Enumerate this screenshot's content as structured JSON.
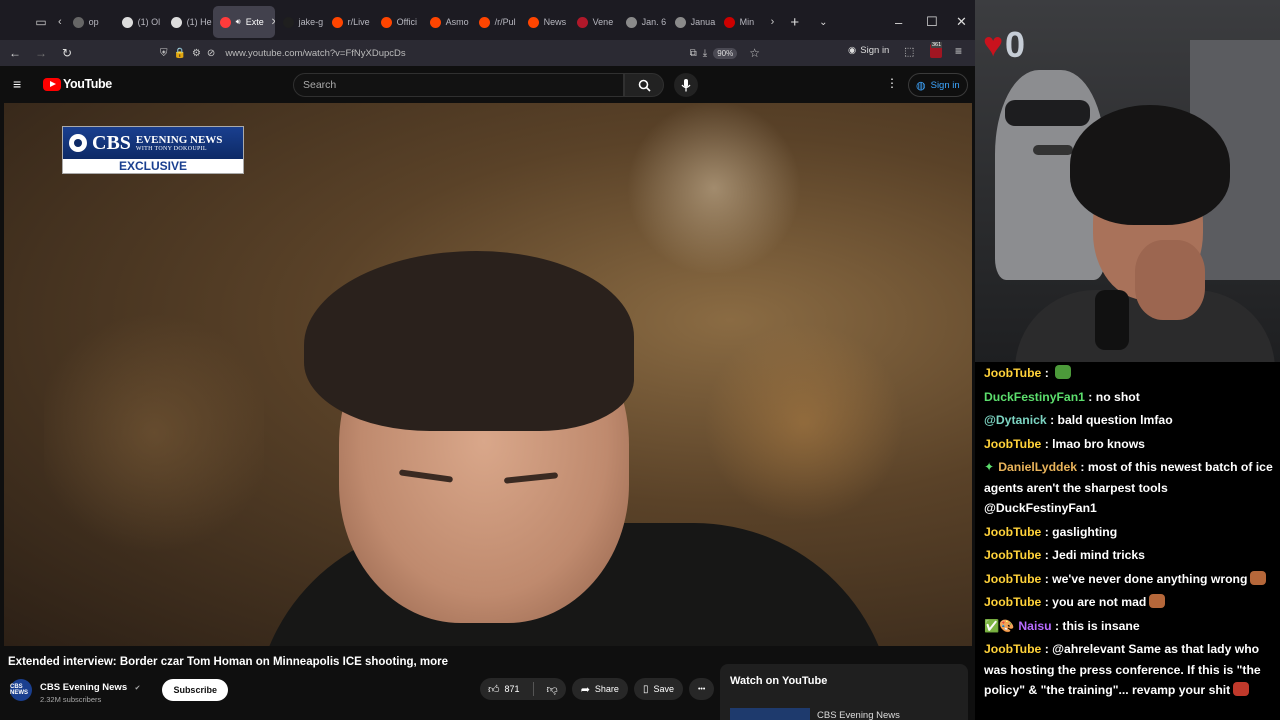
{
  "browser": {
    "tabs": [
      {
        "label": "op",
        "favicon_color": "#666",
        "active": false
      },
      {
        "label": "(1) Ol",
        "favicon_color": "#ddd",
        "active": false
      },
      {
        "label": "(1) He",
        "favicon_color": "#ddd",
        "active": false
      },
      {
        "label": "Exte",
        "favicon_color": "#ff3b3b",
        "active": true
      },
      {
        "label": "jake-g",
        "favicon_color": "#1f1f1f",
        "active": false
      },
      {
        "label": "r/Live",
        "favicon_color": "#ff4500",
        "active": false
      },
      {
        "label": "Offici",
        "favicon_color": "#ff4500",
        "active": false
      },
      {
        "label": "Asmo",
        "favicon_color": "#ff4500",
        "active": false
      },
      {
        "label": "/r/Pul",
        "favicon_color": "#ff4500",
        "active": false
      },
      {
        "label": "News",
        "favicon_color": "#ff4500",
        "active": false
      },
      {
        "label": "Vene",
        "favicon_color": "#b0182a",
        "active": false
      },
      {
        "label": "Jan. 6",
        "favicon_color": "#8a8a8a",
        "active": false
      },
      {
        "label": "Janua",
        "favicon_color": "#8a8a8a",
        "active": false
      },
      {
        "label": "Min",
        "favicon_color": "#cc0000",
        "active": false
      }
    ],
    "url": "www.youtube.com/watch?v=FfNyXDupcDs",
    "zoom": "90%",
    "sign_in": "Sign in",
    "ext_badge": "361"
  },
  "youtube": {
    "logo_text": "YouTube",
    "search_placeholder": "Search",
    "sign_in": "Sign in",
    "video_overlay": {
      "brand": "CBS",
      "brand_line1": "EVENING NEWS",
      "brand_line2": "WITH TONY DOKOUPIL",
      "tag": "EXCLUSIVE"
    },
    "video_title": "Extended interview: Border czar Tom Homan on Minneapolis ICE shooting, more",
    "channel": {
      "avatar_text": "CBS NEWS",
      "name": "CBS Evening News",
      "verified": "✔",
      "subscribers": "2.32M subscribers",
      "subscribe_label": "Subscribe"
    },
    "actions": {
      "likes": "871",
      "share": "Share",
      "save": "Save",
      "more": "•••"
    },
    "watch_panel": {
      "title": "Watch on YouTube",
      "channel": "CBS Evening News"
    }
  },
  "stream": {
    "cam_overlay_icon": "♥",
    "cam_overlay_count": "0"
  },
  "chat": [
    {
      "user": "JoobTube",
      "color": "#ffd23a",
      "prefix": "",
      "text": "",
      "emote": "#4c9a3a"
    },
    {
      "user": "DuckFestinyFan1",
      "color": "#5cde6d",
      "prefix": "",
      "text": "no shot",
      "emote": ""
    },
    {
      "user": "@Dytanick",
      "color": "#7cd4c2",
      "prefix": "",
      "text": "bald question lmfao",
      "emote": ""
    },
    {
      "user": "JoobTube",
      "color": "#ffd23a",
      "prefix": "",
      "text": "lmao bro knows",
      "emote": ""
    },
    {
      "user": "DanielLyddek",
      "color": "#e8b35a",
      "prefix": "✦",
      "text": "most of this newest batch of ice agents aren't the sharpest tools @DuckFestinyFan1",
      "emote": ""
    },
    {
      "user": "JoobTube",
      "color": "#ffd23a",
      "prefix": "",
      "text": "gaslighting",
      "emote": ""
    },
    {
      "user": "JoobTube",
      "color": "#ffd23a",
      "prefix": "",
      "text": "Jedi mind tricks",
      "emote": ""
    },
    {
      "user": "JoobTube",
      "color": "#ffd23a",
      "prefix": "",
      "text": "we've never done anything wrong",
      "emote": "#b5673a"
    },
    {
      "user": "JoobTube",
      "color": "#ffd23a",
      "prefix": "",
      "text": "you are not mad",
      "emote": "#b5673a"
    },
    {
      "user": "Naisu",
      "color": "#b76bff",
      "prefix": "✅🎨",
      "text": "this is insane",
      "emote": ""
    },
    {
      "user": "JoobTube",
      "color": "#ffd23a",
      "prefix": "",
      "text": "@ahrelevant Same as that lady who was hosting the press conference. If this is \"the policy\" & \"the training\"... revamp your shit",
      "emote": "#c0392b"
    }
  ]
}
